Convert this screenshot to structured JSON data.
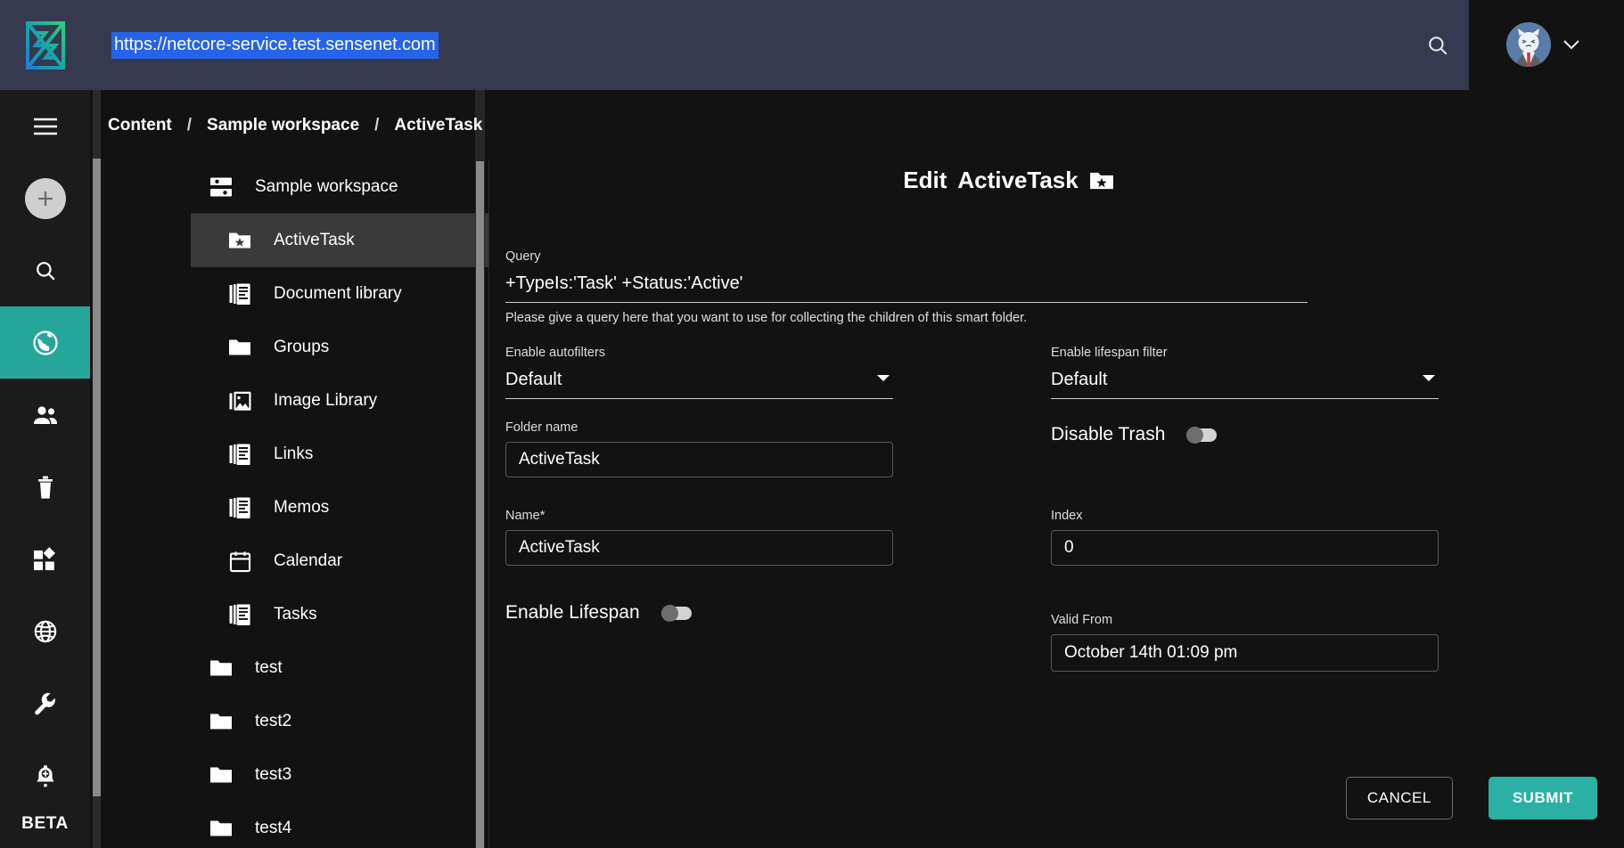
{
  "header": {
    "url": "https://netcore-service.test.sensenet.com",
    "logo_name": "sensenet-logo",
    "search_icon": "search-icon",
    "avatar_name": "user-avatar",
    "chevron": "chevron-down-icon"
  },
  "rail": {
    "items": [
      {
        "icon": "hamburger-menu-icon",
        "name": "menu-toggle",
        "active": false
      },
      {
        "icon": "plus-circle-icon",
        "name": "new-content-button",
        "active": false
      },
      {
        "icon": "search-icon",
        "name": "rail-search",
        "active": false
      },
      {
        "icon": "globe-content-icon",
        "name": "rail-content",
        "active": true
      },
      {
        "icon": "users-icon",
        "name": "rail-users",
        "active": false
      },
      {
        "icon": "trash-icon",
        "name": "rail-trash",
        "active": false
      },
      {
        "icon": "apps-grid-icon",
        "name": "rail-content-types",
        "active": false
      },
      {
        "icon": "globe-wire-icon",
        "name": "rail-localization",
        "active": false
      },
      {
        "icon": "wrench-icon",
        "name": "rail-setup",
        "active": false
      },
      {
        "icon": "bell-plus-icon",
        "name": "rail-notifications",
        "active": false
      }
    ],
    "beta_label": "BETA"
  },
  "breadcrumb": {
    "items": [
      "Content",
      "Sample workspace",
      "ActiveTask"
    ],
    "separator": "/"
  },
  "tree": {
    "root": {
      "label": "Sample workspace",
      "icon": "workspace-icon"
    },
    "items": [
      {
        "label": "ActiveTask",
        "icon": "folder-star-icon",
        "level": 1,
        "selected": true
      },
      {
        "label": "Document library",
        "icon": "document-list-icon",
        "level": 1,
        "selected": false
      },
      {
        "label": "Groups",
        "icon": "folder-icon",
        "level": 1,
        "selected": false
      },
      {
        "label": "Image Library",
        "icon": "image-icon",
        "level": 1,
        "selected": false
      },
      {
        "label": "Links",
        "icon": "document-list-icon",
        "level": 1,
        "selected": false
      },
      {
        "label": "Memos",
        "icon": "document-list-icon",
        "level": 1,
        "selected": false
      },
      {
        "label": "Calendar",
        "icon": "calendar-icon",
        "level": 1,
        "selected": false
      },
      {
        "label": "Tasks",
        "icon": "document-list-icon",
        "level": 1,
        "selected": false
      },
      {
        "label": "test",
        "icon": "folder-icon",
        "level": 0,
        "selected": false
      },
      {
        "label": "test2",
        "icon": "folder-icon",
        "level": 0,
        "selected": false
      },
      {
        "label": "test3",
        "icon": "folder-icon",
        "level": 0,
        "selected": false
      },
      {
        "label": "test4",
        "icon": "folder-icon",
        "level": 0,
        "selected": false
      }
    ]
  },
  "main": {
    "title_prefix": "Edit",
    "title_name": "ActiveTask",
    "title_icon": "folder-star-icon",
    "fields": {
      "query": {
        "label": "Query",
        "value": "+TypeIs:'Task' +Status:'Active'",
        "helper": "Please give a query here that you want to use for collecting the children of this smart folder."
      },
      "enable_autofilters": {
        "label": "Enable autofilters",
        "value": "Default"
      },
      "enable_lifespan_filter": {
        "label": "Enable lifespan filter",
        "value": "Default"
      },
      "folder_name": {
        "label": "Folder name",
        "value": "ActiveTask"
      },
      "disable_trash": {
        "label": "Disable Trash",
        "value": "off"
      },
      "name": {
        "label": "Name",
        "required_marker": "*",
        "value": "ActiveTask"
      },
      "index": {
        "label": "Index",
        "value": "0"
      },
      "enable_lifespan": {
        "label": "Enable Lifespan",
        "value": "off"
      },
      "valid_from": {
        "label": "Valid From",
        "value": "October 14th 01:09 pm"
      }
    },
    "buttons": {
      "cancel": "CANCEL",
      "submit": "SUBMIT"
    }
  },
  "colors": {
    "accent_teal": "#26a69a",
    "submit_teal": "#2ab0a5",
    "header_blue": "#353a50",
    "selection_blue": "#2563eb",
    "background": "#121212"
  }
}
